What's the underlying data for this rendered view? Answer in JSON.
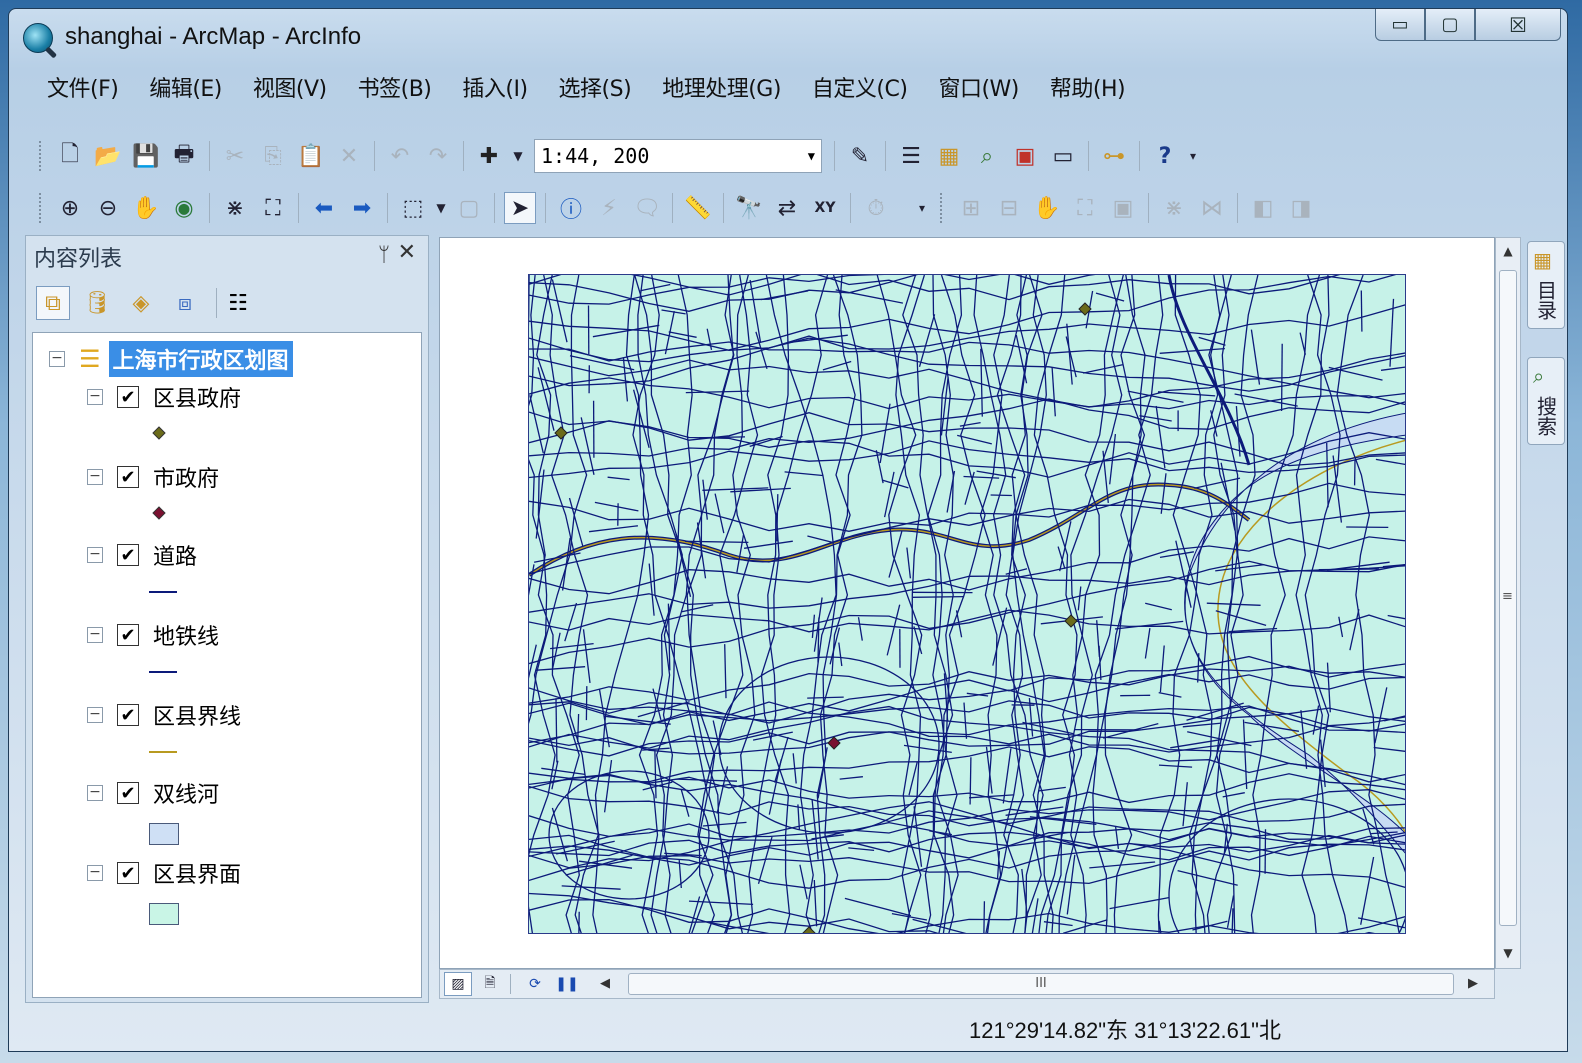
{
  "window": {
    "title": "shanghai - ArcMap - ArcInfo",
    "controls": {
      "minimize": "▭",
      "maximize": "▢",
      "close": "☒"
    }
  },
  "menu": [
    "文件(F)",
    "编辑(E)",
    "视图(V)",
    "书签(B)",
    "插入(I)",
    "选择(S)",
    "地理处理(G)",
    "自定义(C)",
    "窗口(W)",
    "帮助(H)"
  ],
  "standard_toolbar": {
    "scale": "1:44, 200",
    "icons": [
      "new-document-icon",
      "open-icon",
      "save-icon",
      "print-icon",
      "cut-icon",
      "copy-icon",
      "paste-icon",
      "delete-icon",
      "undo-icon",
      "redo-icon",
      "add-data-icon",
      "editor-toolbar-icon",
      "table-of-contents-icon",
      "catalog-icon",
      "search-window-icon",
      "arctoolbox-icon",
      "python-icon",
      "modelbuilder-icon",
      "whats-this-icon"
    ]
  },
  "tools_toolbar": {
    "icons": [
      "zoom-in-icon",
      "zoom-out-icon",
      "pan-icon",
      "full-extent-icon",
      "fixed-zoom-in-icon",
      "fixed-zoom-out-icon",
      "back-icon",
      "forward-icon",
      "select-features-icon",
      "clear-selection-icon",
      "select-elements-icon",
      "identify-icon",
      "hyperlink-icon",
      "html-popup-icon",
      "measure-icon",
      "find-icon",
      "find-route-icon",
      "go-to-xy-icon",
      "time-slider-icon"
    ]
  },
  "toc": {
    "title": "内容列表",
    "pin": "ᛘ",
    "close": "✕",
    "data_frame": "上海市行政区划图",
    "layers": [
      {
        "name": "区县政府",
        "checked": true,
        "symbol": "point",
        "color": "#6b6b1a"
      },
      {
        "name": "市政府",
        "checked": true,
        "symbol": "point",
        "color": "#7a1030"
      },
      {
        "name": "道路",
        "checked": true,
        "symbol": "line",
        "color": "#0c1a7a"
      },
      {
        "name": "地铁线",
        "checked": true,
        "symbol": "line",
        "color": "#0c1a7a"
      },
      {
        "name": "区县界线",
        "checked": true,
        "symbol": "line",
        "color": "#b89a20"
      },
      {
        "name": "双线河",
        "checked": true,
        "symbol": "fill",
        "color": "#cfe0f5"
      },
      {
        "name": "区县界面",
        "checked": true,
        "symbol": "fill",
        "color": "#c9f5e6"
      }
    ]
  },
  "map": {
    "background": "#c6f2e8",
    "river_color": "#c7dcf3",
    "road_color": "#0c1a7a",
    "boundary_color": "#b89a20"
  },
  "scrollbar": {
    "thumb_grip": "III",
    "vgrip": "≡"
  },
  "dock": [
    {
      "label": "目录",
      "icon": "catalog-icon"
    },
    {
      "label": "搜索",
      "icon": "search-icon"
    }
  ],
  "status": {
    "coordinates": "121°29'14.82\"东  31°13'22.61\"北"
  }
}
